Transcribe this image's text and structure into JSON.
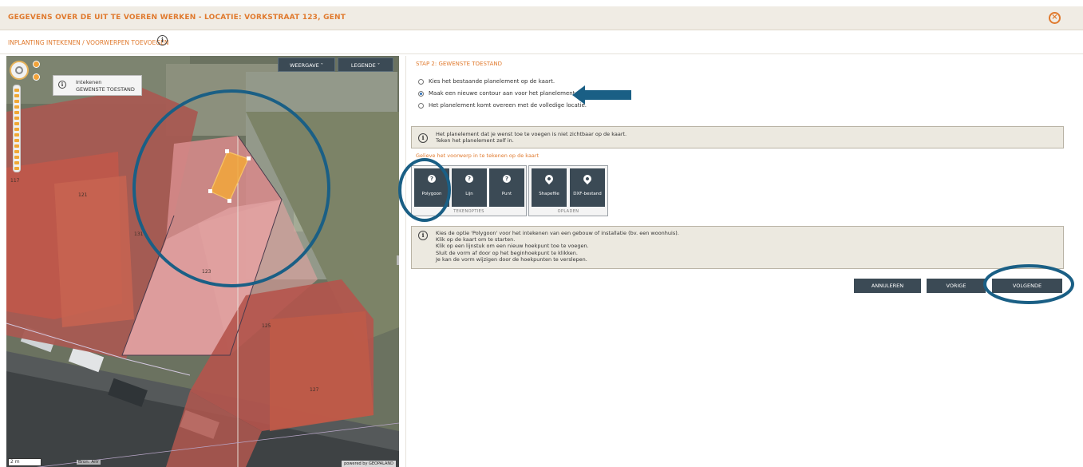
{
  "header": {
    "title": "GEGEVENS OVER DE UIT TE VOEREN WERKEN - LOCATIE: VORKSTRAAT 123, GENT",
    "close_icon": "×"
  },
  "subheader": {
    "title": "INPLANTING INTEKENEN / VOORWERPEN TOEVOEGEN",
    "info_icon": "i"
  },
  "map": {
    "view_button": "WEERGAVE ˅",
    "legend_button": "LEGENDE ˅",
    "draw_status": {
      "line1": "Intekenen",
      "line2": "GEWENSTE TOESTAND"
    },
    "parcel_labels": [
      "121",
      "123",
      "125",
      "127",
      "117",
      "131"
    ],
    "scale": "2 m",
    "source": "Bron: AIV",
    "powered_by": "powered by GEOPALAND"
  },
  "panel": {
    "step_title": "STAP 2: GEWENSTE TOESTAND",
    "options": [
      {
        "label": "Kies het bestaande planelement op de kaart.",
        "checked": false
      },
      {
        "label": "Maak een nieuwe contour aan voor het planelement.",
        "checked": true
      },
      {
        "label": "Het planelement komt overeen met de volledige locatie.",
        "checked": false
      }
    ],
    "notice": {
      "line1": "Het planelement dat je wenst toe te voegen is niet zichtbaar op de kaart.",
      "line2": "Teken het planelement zelf in."
    },
    "instruction": "Gelieve het voorwerp in te tekenen op de kaart",
    "draw_tools": {
      "caption": "TEKENOPTIES",
      "items": [
        {
          "label": "Polygoon",
          "icon": "question-icon"
        },
        {
          "label": "Lijn",
          "icon": "question-icon"
        },
        {
          "label": "Punt",
          "icon": "question-icon"
        }
      ]
    },
    "upload_tools": {
      "caption": "OPLADEN",
      "items": [
        {
          "label": "Shapefile",
          "icon": "pin-icon"
        },
        {
          "label": "DXF-bestand",
          "icon": "pin-icon"
        }
      ]
    },
    "help": {
      "lines": [
        "Kies de optie 'Polygoon' voor het intekenen van een gebouw of installatie (bv. een woonhuis).",
        "Klik op de kaart om te starten.",
        "Klik op een lijnstuk om een nieuw hoekpunt toe te voegen.",
        "Sluit de vorm af door op het beginhoekpunt te klikken.",
        "Je kan de vorm wijzigen door de hoekpunten te verslepen."
      ]
    },
    "buttons": {
      "cancel": "ANNULEREN",
      "previous": "VORIGE",
      "next": "VOLGENDE"
    }
  },
  "colors": {
    "accent": "#e07a2e",
    "button": "#3b4a55",
    "annotation": "#1a5f85",
    "polygon": "#f2a73a"
  }
}
